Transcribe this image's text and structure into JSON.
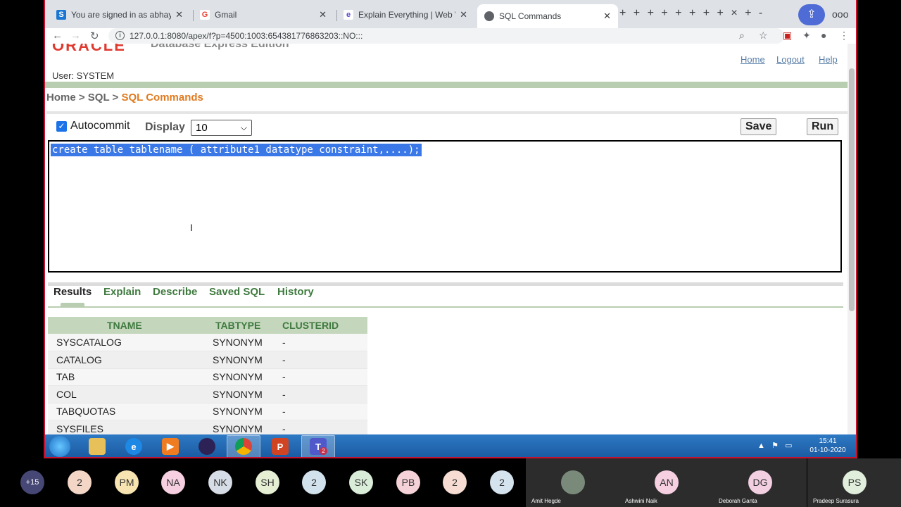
{
  "browser": {
    "tabs": [
      {
        "title": "You are signed in as abhayakumar",
        "favicon": "S",
        "favicon_color": "#1976d2"
      },
      {
        "title": "Gmail",
        "favicon": "G",
        "favicon_color": "#ea4335"
      },
      {
        "title": "Explain Everything | Web Whiteboard",
        "favicon": "e",
        "favicon_color": "#5b4ccf"
      },
      {
        "title": "SQL Commands",
        "favicon": "",
        "favicon_color": "#5f6368"
      }
    ],
    "url": "127.0.0.1:8080/apex/f?p=4500:1003:654381776863203::NO:::",
    "extra_tabs": "+ + + + + + + + × + -",
    "more": "ooo"
  },
  "page": {
    "logo_text": "ORACLE",
    "logo_subtitle": "Database Express Edition",
    "user_label": "User: SYSTEM",
    "links": {
      "home": "Home",
      "logout": "Logout",
      "help": "Help"
    },
    "breadcrumb": {
      "home": "Home",
      "sep1": " > ",
      "sql": "SQL",
      "sep2": " > ",
      "current": "SQL Commands"
    },
    "autocommit_label": "Autocommit",
    "display_label": "Display",
    "display_value": "10",
    "save_label": "Save",
    "run_label": "Run",
    "sql_text": "create table tablename ( attribute1 datatype constraint,....);",
    "result_tabs": [
      "Results",
      "Explain",
      "Describe",
      "Saved SQL",
      "History"
    ],
    "table": {
      "headers": [
        "TNAME",
        "TABTYPE",
        "CLUSTERID"
      ],
      "rows": [
        [
          "SYSCATALOG",
          "SYNONYM",
          "-"
        ],
        [
          "CATALOG",
          "SYNONYM",
          "-"
        ],
        [
          "TAB",
          "SYNONYM",
          "-"
        ],
        [
          "COL",
          "SYNONYM",
          "-"
        ],
        [
          "TABQUOTAS",
          "SYNONYM",
          "-"
        ],
        [
          "SYSFILES",
          "SYNONYM",
          "-"
        ]
      ]
    }
  },
  "taskbar": {
    "time": "15:41",
    "date": "01-10-2020",
    "apps": [
      "explorer-icon",
      "ie-icon",
      "media-icon",
      "eclipse-icon",
      "chrome-icon",
      "powerpoint-icon",
      "teams-icon"
    ],
    "teams_badge": "2"
  },
  "participants": {
    "avatars": [
      {
        "initials": "+15",
        "color": "#464775",
        "text_color": "#ffffff"
      },
      {
        "initials": "2",
        "color": "#f4d6c6"
      },
      {
        "initials": "PM",
        "color": "#f7e4b0"
      },
      {
        "initials": "NA",
        "color": "#f6cfe0"
      },
      {
        "initials": "NK",
        "color": "#d7dde6"
      },
      {
        "initials": "SH",
        "color": "#e6efd3"
      },
      {
        "initials": "2",
        "color": "#d2e2ec"
      },
      {
        "initials": "SK",
        "color": "#d9edd9"
      },
      {
        "initials": "PB",
        "color": "#f5d2d8"
      },
      {
        "initials": "2",
        "color": "#f6dcd2"
      },
      {
        "initials": "2",
        "color": "#d4e3ee"
      }
    ],
    "tiles": [
      {
        "name": "Amit Hegde",
        "initials": "",
        "color": "#7a8a7a"
      },
      {
        "name": "Ashwini Naik",
        "initials": "AN",
        "color": "#f6cfe0"
      },
      {
        "name": "Deborah Ganta",
        "initials": "DG",
        "color": "#f3cfe2"
      },
      {
        "name": "Pradeep Surasura",
        "initials": "PS",
        "color": "#e0eedb"
      }
    ]
  }
}
